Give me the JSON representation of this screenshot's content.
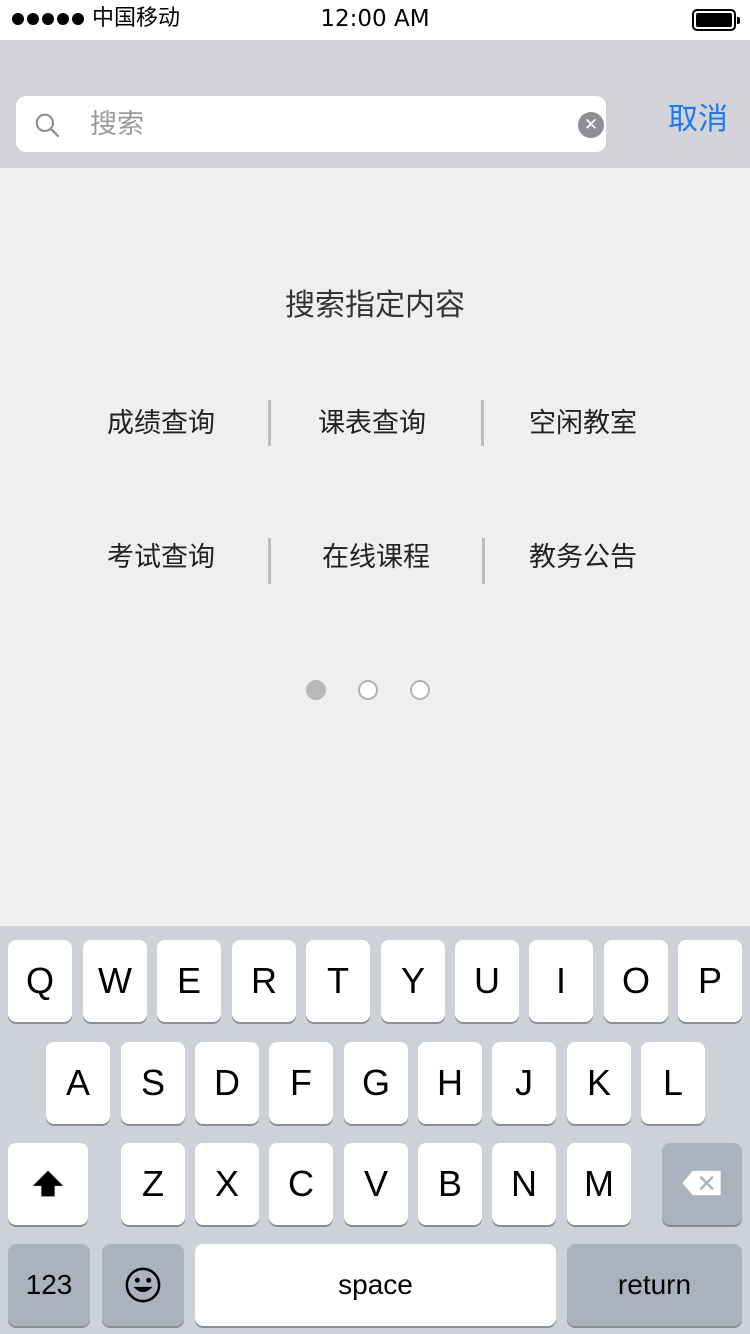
{
  "status_bar": {
    "carrier": "中国移动",
    "time": "12:00 AM"
  },
  "search": {
    "placeholder": "搜索",
    "cancel_label": "取消",
    "icons": {
      "search": "search-icon",
      "clear": "clear-icon"
    }
  },
  "content": {
    "title": "搜索指定内容",
    "items": [
      {
        "label": "成绩查询"
      },
      {
        "label": "课表查询"
      },
      {
        "label": "空闲教室"
      },
      {
        "label": "考试查询"
      },
      {
        "label": "在线课程"
      },
      {
        "label": "教务公告"
      }
    ],
    "page_count": 3,
    "current_page": 1
  },
  "keyboard": {
    "row1": [
      "Q",
      "W",
      "E",
      "R",
      "T",
      "Y",
      "U",
      "I",
      "O",
      "P"
    ],
    "row2": [
      "A",
      "S",
      "D",
      "F",
      "G",
      "H",
      "J",
      "K",
      "L"
    ],
    "row3": [
      "Z",
      "X",
      "C",
      "V",
      "B",
      "N",
      "M"
    ],
    "numbers_label": "123",
    "space_label": "space",
    "return_label": "return",
    "icons": {
      "shift": "shift-icon",
      "emoji": "emoji-icon",
      "delete": "delete-icon"
    }
  },
  "colors": {
    "accent": "#1a7cf5",
    "header_bg": "#d2d2d7",
    "page_bg": "#efefef",
    "keyboard_bg": "#cdd2d8"
  }
}
